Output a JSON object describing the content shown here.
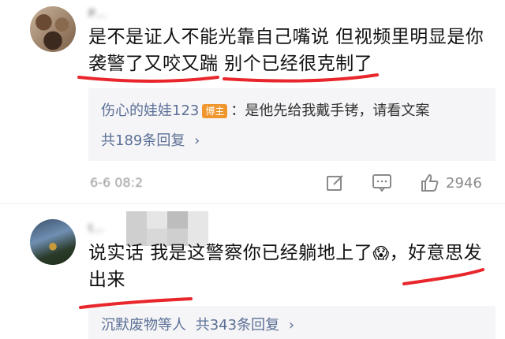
{
  "comment1": {
    "username": "P…",
    "text_line1": "是不是证人不能光靠自己嘴说 但视频里明显是你",
    "text_line2": "袭警了又咬又踹 别个已经很克制了",
    "reply": {
      "author": "伤心的娃娃123",
      "badge": "博主",
      "text": "：是他先给我戴手铐，请看文案"
    },
    "more_replies": "共189条回复",
    "timestamp": "6-6 08:2",
    "like_count": "2946"
  },
  "comment2": {
    "username": "t…",
    "text_line1": "说实话 我是这警察你已经躺地上了",
    "text_line1_end": "，好意思发",
    "text_line2": "出来",
    "emoji": "😱",
    "reply_summary": "沉默废物等人",
    "more_replies": "共343条回复"
  },
  "icons": {
    "chevron": "›",
    "edit": "edit-icon",
    "comment": "comment-icon",
    "like": "like-icon"
  },
  "colors": {
    "underline": "#e8262b",
    "link": "#5b6f96",
    "badge": "#f0962e"
  }
}
